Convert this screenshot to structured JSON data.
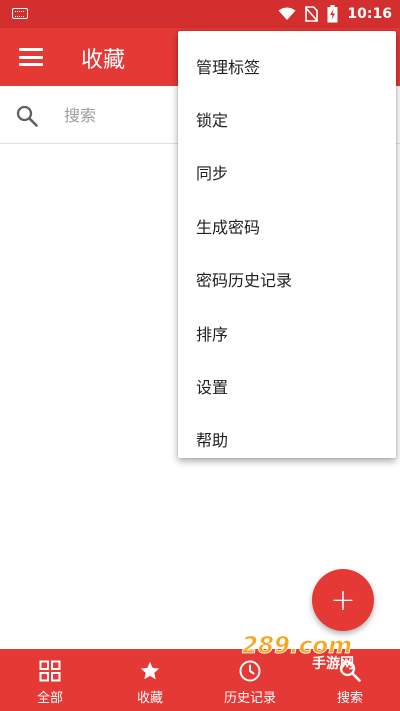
{
  "statusbar": {
    "time": "10:16",
    "icons": [
      "keyboard-icon",
      "wifi-icon",
      "no-sim-icon",
      "battery-charging-icon"
    ]
  },
  "appbar": {
    "title": "收藏",
    "menu_icon": "hamburger-menu-icon"
  },
  "search": {
    "placeholder": "搜索",
    "icon": "search-icon"
  },
  "dropdown": {
    "items": [
      {
        "label": "管理标签"
      },
      {
        "label": "锁定"
      },
      {
        "label": "同步"
      },
      {
        "label": "生成密码"
      },
      {
        "label": "密码历史记录"
      },
      {
        "label": "排序"
      },
      {
        "label": "设置"
      },
      {
        "label": "帮助"
      }
    ]
  },
  "fab": {
    "label": "+",
    "icon": "add-icon"
  },
  "bottom_nav": {
    "items": [
      {
        "label": "全部",
        "icon": "grid-icon"
      },
      {
        "label": "收藏",
        "icon": "star-icon"
      },
      {
        "label": "历史记录",
        "icon": "history-icon"
      },
      {
        "label": "搜索",
        "icon": "search-icon"
      }
    ]
  },
  "watermark": {
    "text": "289.com",
    "subtext": "手游网"
  },
  "colors": {
    "primary": "#e53935",
    "status_bar": "#d32f2f"
  }
}
